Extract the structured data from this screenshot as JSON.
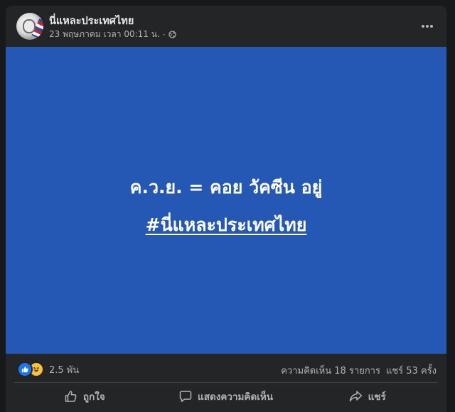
{
  "post": {
    "page_name": "นี่แหละประเทศไทย",
    "timestamp": "23 พฤษภาคม เวลา 00:11 น.",
    "separator": "·",
    "privacy_icon": "globe-icon",
    "more_icon": "more-options-icon"
  },
  "media": {
    "background": "#2458b4",
    "line1": "ค.ว.ย. = คอย วัคซีน อยู่",
    "hashtag": "#นี่แหละประเทศไทย"
  },
  "stats": {
    "reactions": [
      "like-reaction-icon",
      "haha-reaction-icon"
    ],
    "reaction_count": "2.5 พัน",
    "comments": "ความคิดเห็น 18 รายการ",
    "shares": "แชร์ 53 ครั้ง"
  },
  "actions": {
    "like_label": "ถูกใจ",
    "comment_label": "แสดงความคิดเห็น",
    "share_label": "แชร์"
  },
  "colors": {
    "page_bg": "#18191a",
    "card_bg": "#242526",
    "primary_text": "#e4e6eb",
    "secondary_text": "#b0b3b8",
    "like_blue": "#1877f2"
  }
}
